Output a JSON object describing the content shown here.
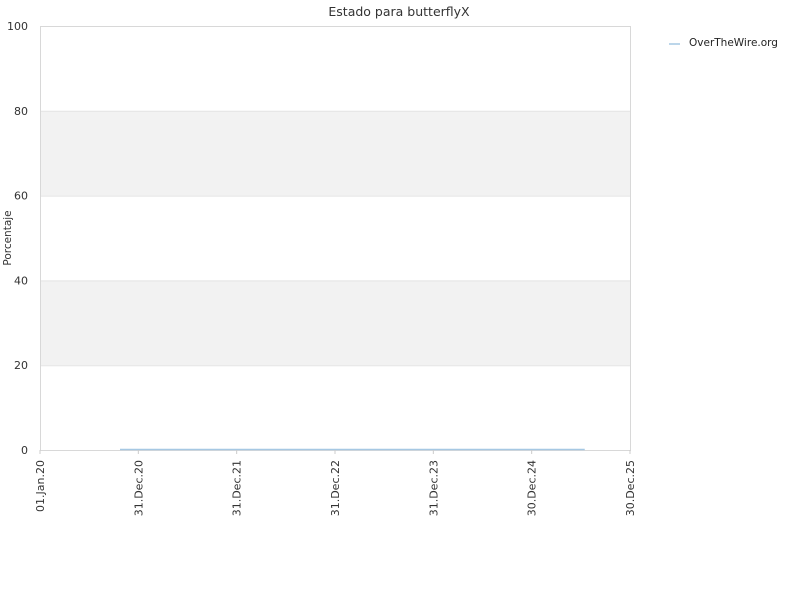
{
  "chart_data": {
    "type": "line",
    "title": "Estado para butterflyX",
    "ylabel": "Porcentaje",
    "xlabel": "",
    "ylim": [
      0,
      100
    ],
    "yticks": [
      "0",
      "20",
      "40",
      "60",
      "80",
      "100"
    ],
    "xlim": [
      "2020-01-01",
      "2025-12-30"
    ],
    "xticks": [
      {
        "date": "2020-01-01",
        "label": "01.Jan.20"
      },
      {
        "date": "2020-12-31",
        "label": "31.Dec.20"
      },
      {
        "date": "2021-12-31",
        "label": "31.Dec.21"
      },
      {
        "date": "2022-12-31",
        "label": "31.Dec.22"
      },
      {
        "date": "2023-12-31",
        "label": "31.Dec.23"
      },
      {
        "date": "2024-12-30",
        "label": "30.Dec.24"
      },
      {
        "date": "2025-12-30",
        "label": "30.Dec.25"
      }
    ],
    "grid": true,
    "band_colors": [
      "#ffffff",
      "#f2f2f2"
    ],
    "legend_position": "top-right",
    "series": [
      {
        "name": "OverTheWire.org",
        "color": "#a6c8e3",
        "x": [
          "2020-10-24",
          "2025-07-15"
        ],
        "y": [
          0,
          0
        ]
      }
    ]
  }
}
